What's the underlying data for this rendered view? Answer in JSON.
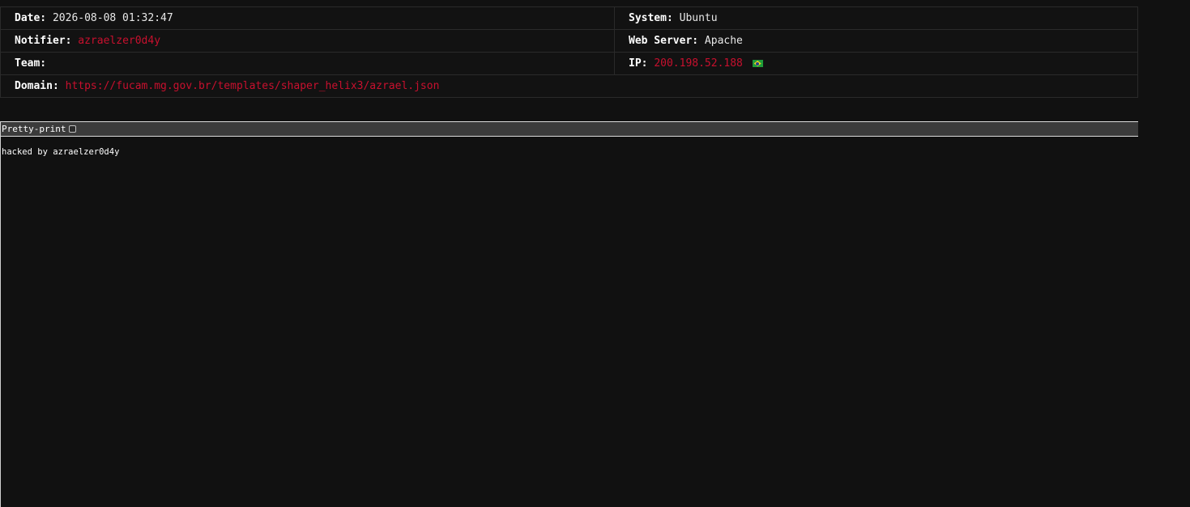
{
  "info": {
    "date_label": "Date:",
    "date_value": "2026-08-08 01:32:47",
    "system_label": "System:",
    "system_value": "Ubuntu",
    "notifier_label": "Notifier:",
    "notifier_value": "azraelzer0d4y",
    "webserver_label": "Web Server:",
    "webserver_value": "Apache",
    "team_label": "Team:",
    "team_value": "",
    "ip_label": "IP:",
    "ip_value": "200.198.52.188",
    "ip_flag_icon": "brazil-flag-icon",
    "domain_label": "Domain:",
    "domain_value": "https://fucam.mg.gov.br/templates/shaper_helix3/azrael.json"
  },
  "viewer": {
    "pretty_print_label": "Pretty-print",
    "pretty_print_checked": false,
    "content": "hacked by azraelzer0d4y"
  },
  "colors": {
    "background": "#111111",
    "accent_red": "#c8102e",
    "border": "#2a2a2a",
    "toolbar": "#3b3b3b"
  }
}
